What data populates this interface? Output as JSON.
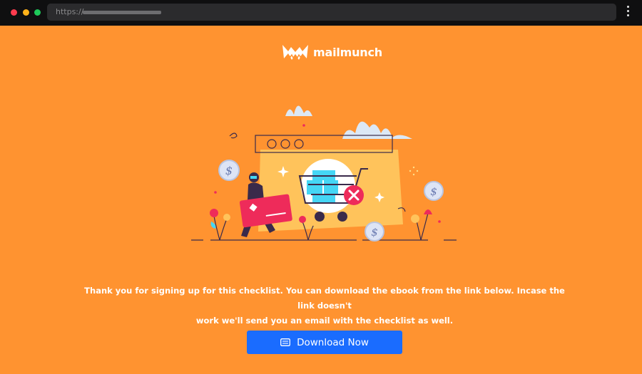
{
  "browser": {
    "url_prefix": "https://",
    "icons": [
      "close-dot",
      "minimize-dot",
      "maximize-dot",
      "kebab-menu-icon"
    ]
  },
  "brand": {
    "name": "mailmunch",
    "logo_icon": "mailmunch-logo-icon",
    "background_color": "#ff9330"
  },
  "illustration": {
    "semantic": "online-shopping-cart-payment-declined"
  },
  "message": {
    "line1": "Thank you for signing up for this checklist. You can download the ebook from the link below. Incase the link doesn't",
    "line2": "work we'll send you an email with the checklist as well."
  },
  "cta": {
    "label": "Download Now",
    "icon": "ebook-icon",
    "color": "#1a6cff"
  }
}
